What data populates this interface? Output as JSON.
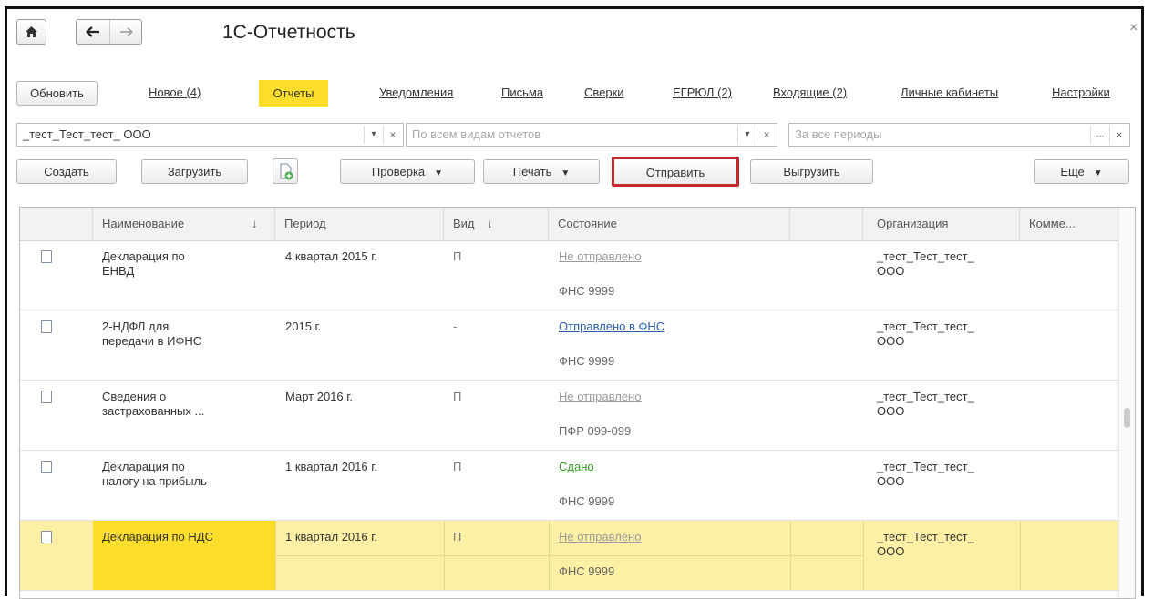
{
  "window": {
    "title": "1С-Отчетность",
    "close_label": "×"
  },
  "nav": {
    "home_icon": "home-icon",
    "back_icon": "arrow-left-icon",
    "forward_icon": "arrow-right-icon"
  },
  "tabs": {
    "refresh_label": "Обновить",
    "new_label": "Новое (4)",
    "items": [
      {
        "label": "Отчеты",
        "active": true
      },
      {
        "label": "Уведомления"
      },
      {
        "label": "Письма"
      },
      {
        "label": "Сверки"
      },
      {
        "label": "ЕГРЮЛ (2)"
      },
      {
        "label": "Входящие (2)"
      },
      {
        "label": "Личные кабинеты"
      },
      {
        "label": "Настройки"
      }
    ]
  },
  "filters": {
    "organization": "_тест_Тест_тест_ ООО",
    "report_type_placeholder": "По всем видам отчетов",
    "period_placeholder": "За все периоды",
    "ellipsis": "...",
    "clear": "×",
    "dropdown": "▾"
  },
  "toolbar": {
    "create": "Создать",
    "load": "Загрузить",
    "check": "Проверка",
    "print": "Печать",
    "send": "Отправить",
    "export": "Выгрузить",
    "more": "Еще",
    "caret": "▼"
  },
  "table": {
    "columns": [
      "Наименование",
      "Период",
      "Вид",
      "Состояние",
      "Организация",
      "Комме..."
    ],
    "sort_arrow": "↓",
    "rows": [
      {
        "name": "Декларация по\nЕНВД",
        "period": "4 квартал 2015 г.",
        "kind": "П",
        "status": "Не отправлено",
        "status_color": "#9a9a9a",
        "authority": "ФНС 9999",
        "org": "_тест_Тест_тест_\nООО",
        "selected": false
      },
      {
        "name": "2-НДФЛ для\nпередачи в ИФНС",
        "period": "2015 г.",
        "kind": "-",
        "status": "Отправлено в ФНС",
        "status_color": "#2a5db0",
        "authority": "ФНС 9999",
        "org": "_тест_Тест_тест_\nООО",
        "selected": false
      },
      {
        "name": "Сведения о\nзастрахованных ...",
        "period": "Март 2016 г.",
        "kind": "П",
        "status": "Не отправлено",
        "status_color": "#9a9a9a",
        "authority": "ПФР 099-099",
        "org": "_тест_Тест_тест_\nООО",
        "selected": false
      },
      {
        "name": "Декларация по\nналогу на прибыль",
        "period": "1 квартал 2016 г.",
        "kind": "П",
        "status": "Сдано",
        "status_color": "#3a9a2a",
        "authority": "ФНС 9999",
        "org": "_тест_Тест_тест_\nООО",
        "selected": false
      },
      {
        "name": "Декларация по НДС",
        "period": "1 квартал 2016 г.",
        "kind": "П",
        "status": "Не отправлено",
        "status_color": "#9a9a9a",
        "authority": "ФНС 9999",
        "org": "_тест_Тест_тест_\nООО",
        "selected": true
      }
    ]
  },
  "colors": {
    "accent_yellow": "#fddd2b",
    "selection": "#fdf0a4",
    "highlight_border": "#c0282d"
  }
}
